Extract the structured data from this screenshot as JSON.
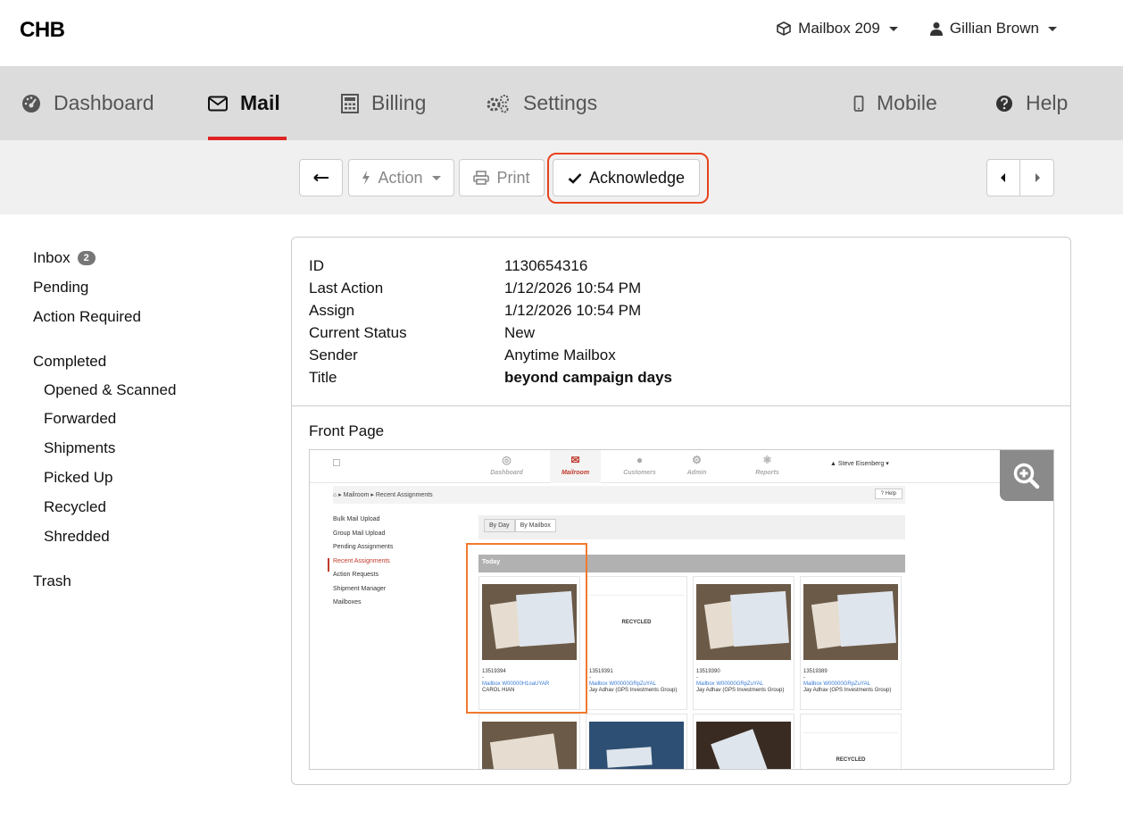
{
  "brand": "CHB",
  "top": {
    "mailbox": "Mailbox 209",
    "user": "Gillian Brown"
  },
  "nav": [
    {
      "label": "Dashboard",
      "icon": "dashboard-gauge-icon",
      "active": false
    },
    {
      "label": "Mail",
      "icon": "envelope-icon",
      "active": true
    },
    {
      "label": "Billing",
      "icon": "calculator-icon",
      "active": false
    },
    {
      "label": "Settings",
      "icon": "gears-icon",
      "active": false
    },
    {
      "label": "Mobile",
      "icon": "mobile-icon",
      "active": false
    },
    {
      "label": "Help",
      "icon": "question-circle-icon",
      "active": false
    }
  ],
  "toolbar": {
    "back_icon": "arrow-left-icon",
    "action_label": "Action",
    "print_label": "Print",
    "acknowledge_label": "Acknowledge"
  },
  "sidebar": {
    "inbox": "Inbox",
    "inbox_count": "2",
    "pending": "Pending",
    "action_required": "Action Required",
    "completed": "Completed",
    "opened_scanned": "Opened & Scanned",
    "forwarded": "Forwarded",
    "shipments": "Shipments",
    "picked_up": "Picked Up",
    "recycled": "Recycled",
    "shredded": "Shredded",
    "trash": "Trash"
  },
  "details": {
    "id_label": "ID",
    "id": "1130654316",
    "last_action_label": "Last Action",
    "last_action": "1/12/2026 10:54 PM",
    "assign_label": "Assign",
    "assign": "1/12/2026 10:54 PM",
    "status_label": "Current Status",
    "status": "New",
    "sender_label": "Sender",
    "sender": "Anytime Mailbox",
    "title_label": "Title",
    "title": "beyond campaign days"
  },
  "front_page_label": "Front Page",
  "preview": {
    "nav": [
      "Dashboard",
      "Mailroom",
      "Customers",
      "Admin",
      "Reports"
    ],
    "user": "Steve Eisenberg",
    "breadcrumb_1": "Mailroom",
    "breadcrumb_2": "Recent Assignments",
    "help": "Help",
    "side": [
      "Bulk Mail Upload",
      "Group Mail Upload",
      "Pending Assignments",
      "Recent Assignments",
      "Action Requests",
      "Shipment Manager",
      "Mailboxes"
    ],
    "tab_day": "By Day",
    "tab_mailbox": "By Mailbox",
    "today": "Today",
    "recycled": "RECYCLED",
    "cards": [
      {
        "id": "13519394",
        "dash": "-",
        "mailbox": "Mailbox W00000H1oaUYAR",
        "name": "CAROL HIAN"
      },
      {
        "id": "13519391",
        "dash": "-",
        "mailbox": "Mailbox W00000GRpZuYAL",
        "name": "Jay Adhav (GPS Investments Group)"
      },
      {
        "id": "13519390",
        "dash": "-",
        "mailbox": "Mailbox W00000GRpZuYAL",
        "name": "Jay Adhav (GPS Investments Group)"
      },
      {
        "id": "13519389",
        "dash": "-",
        "mailbox": "Mailbox W00000GRpZuYAL",
        "name": "Jay Adhav (GPS Investments Group)"
      }
    ]
  },
  "colors": {
    "accent_red": "#e02424",
    "highlight_orange": "#e8421c"
  }
}
